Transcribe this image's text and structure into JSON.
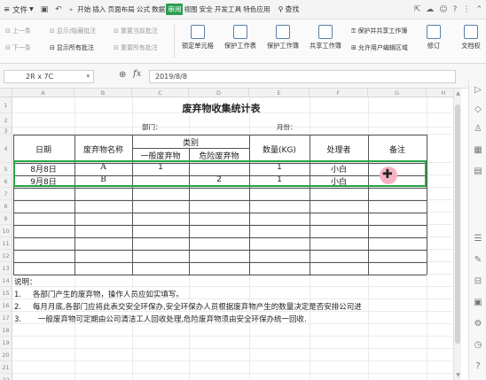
{
  "menubar": {
    "file_label": "文件",
    "tabs": [
      "开始",
      "插入",
      "页面布局",
      "公式",
      "数据",
      "审阅",
      "视图",
      "安全",
      "开发工具",
      "特色应用"
    ],
    "active_tab": "审阅",
    "search_label": "查找"
  },
  "ribbon": {
    "prev_comment": "上一条",
    "next_comment": "下一条",
    "show_hide_comments": "显示/隐藏批注",
    "show_all_comments": "显示所有批注",
    "reset_current_comment": "重置当前批注",
    "reset_all_comments": "重置所有批注",
    "lock_cell": "锁定单元格",
    "protect_sheet": "保护工作表",
    "protect_workbook": "保护工作簿",
    "share_workbook": "共享工作簿",
    "protect_share": "保护并共享工作簿",
    "allow_edit_ranges": "允许用户编辑区域",
    "track_changes": "修订",
    "document_right": "文档权"
  },
  "formula_bar": {
    "name_box": "2R x 7C",
    "formula_value": "2019/8/8"
  },
  "columns": [
    "A",
    "B",
    "C",
    "D",
    "E",
    "F",
    "G",
    "H"
  ],
  "rows": [
    "1",
    "2",
    "3",
    "4",
    "5",
    "6",
    "7",
    "8",
    "9",
    "10",
    "11",
    "12",
    "13",
    "14",
    "15",
    "16",
    "17",
    "18",
    "19",
    "20",
    "21",
    "22"
  ],
  "sheet": {
    "title": "废弃物收集统计表",
    "dept_label": "部门：",
    "month_label": "月份：",
    "headers": {
      "date": "日期",
      "waste_name": "废弃物名称",
      "category": "类别",
      "general": "一般废弃物",
      "hazardous": "危险废弃物",
      "quantity": "数量(KG)",
      "handler": "处理者",
      "remarks": "备注"
    },
    "data_rows": [
      {
        "date": "8月8日",
        "name": "A",
        "general": "1",
        "hazardous": "",
        "qty": "1",
        "handler": "小白",
        "remarks": ""
      },
      {
        "date": "9月8日",
        "name": "B",
        "general": "",
        "hazardous": "2",
        "qty": "1",
        "handler": "小白",
        "remarks": ""
      }
    ],
    "notes_title": "说明：",
    "notes": [
      {
        "num": "1.",
        "text": "各部门产生的废弃物，操作人员应如实填写。"
      },
      {
        "num": "2.",
        "text": "每月月底,各部门应将此表交安全环保办,安全环保办人员根据废弃物产生的数量决定是否安排公司进"
      },
      {
        "num": "3.",
        "text": "一般废弃物可定期由公司清洁工人回收处理,危险废弃物须由安全环保办统一回收."
      }
    ]
  },
  "colors": {
    "accent": "#2b9e4f",
    "selection": "#27a347",
    "cursor": "#f7b3c4"
  }
}
